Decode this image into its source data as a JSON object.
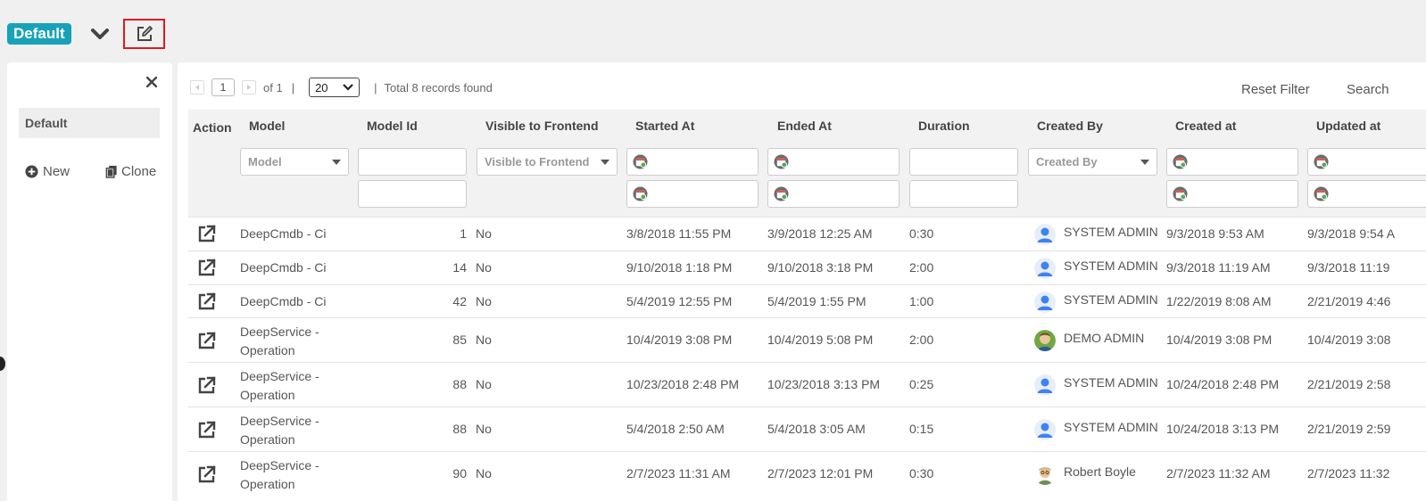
{
  "view": {
    "badge": "Default"
  },
  "left": {
    "item": "Default",
    "new_label": "New",
    "clone_label": "Clone"
  },
  "pager": {
    "page": "1",
    "of": "of 1",
    "sep": "|",
    "size": "20",
    "sep2": "|",
    "total": "Total 8 records found"
  },
  "toolbar": {
    "reset": "Reset Filter",
    "search": "Search"
  },
  "columns": {
    "action": "Action",
    "model": "Model",
    "model_id": "Model Id",
    "visible": "Visible to Frontend",
    "started": "Started At",
    "ended": "Ended At",
    "duration": "Duration",
    "created_by": "Created By",
    "created_at": "Created at",
    "updated_at": "Updated at"
  },
  "filters": {
    "model": "Model",
    "visible": "Visible to Frontend",
    "created_by": "Created By"
  },
  "rows": [
    {
      "model1": "DeepCmdb - Ci",
      "model2": "",
      "id": "1",
      "visible": "No",
      "started": "3/8/2018 11:55 PM",
      "ended": "3/9/2018 12:25 AM",
      "duration": "0:30",
      "avatar": "user-silhouette",
      "by": "SYSTEM ADMIN",
      "created": "9/3/2018 9:53 AM",
      "updated": "9/3/2018 9:54 A"
    },
    {
      "model1": "DeepCmdb - Ci",
      "model2": "",
      "id": "14",
      "visible": "No",
      "started": "9/10/2018 1:18 PM",
      "ended": "9/10/2018 3:18 PM",
      "duration": "2:00",
      "avatar": "user-silhouette",
      "by": "SYSTEM ADMIN",
      "created": "9/3/2018 11:19 AM",
      "updated": "9/3/2018 11:19"
    },
    {
      "model1": "DeepCmdb - Ci",
      "model2": "",
      "id": "42",
      "visible": "No",
      "started": "5/4/2019 12:55 PM",
      "ended": "5/4/2019 1:55 PM",
      "duration": "1:00",
      "avatar": "user-silhouette",
      "by": "SYSTEM ADMIN",
      "created": "1/22/2019 8:08 AM",
      "updated": "2/21/2019 4:46"
    },
    {
      "model1": "DeepService -",
      "model2": "Operation",
      "id": "85",
      "visible": "No",
      "started": "10/4/2019 3:08 PM",
      "ended": "10/4/2019 5:08 PM",
      "duration": "2:00",
      "avatar": "person-photo",
      "by": "DEMO ADMIN",
      "created": "10/4/2019 3:08 PM",
      "updated": "10/4/2019 3:08"
    },
    {
      "model1": "DeepService -",
      "model2": "Operation",
      "id": "88",
      "visible": "No",
      "started": "10/23/2018 2:48 PM",
      "ended": "10/23/2018 3:13 PM",
      "duration": "0:25",
      "avatar": "user-silhouette",
      "by": "SYSTEM ADMIN",
      "created": "10/24/2018 2:48 PM",
      "updated": "2/21/2019 2:58"
    },
    {
      "model1": "DeepService -",
      "model2": "Operation",
      "id": "88",
      "visible": "No",
      "started": "5/4/2018 2:50 AM",
      "ended": "5/4/2018 3:05 AM",
      "duration": "0:15",
      "avatar": "user-silhouette",
      "by": "SYSTEM ADMIN",
      "created": "10/24/2018 3:13 PM",
      "updated": "2/21/2019 2:59"
    },
    {
      "model1": "DeepService -",
      "model2": "Operation",
      "id": "90",
      "visible": "No",
      "started": "2/7/2023 11:31 AM",
      "ended": "2/7/2023 12:01 PM",
      "duration": "0:30",
      "avatar": "cartoon-person",
      "by": "Robert Boyle",
      "created": "2/7/2023 11:32 AM",
      "updated": "2/7/2023 11:32"
    }
  ],
  "colors": {
    "badge": "#17a2b8",
    "highlight": "#e0191e",
    "avatar_blue": "#3b82f6"
  }
}
